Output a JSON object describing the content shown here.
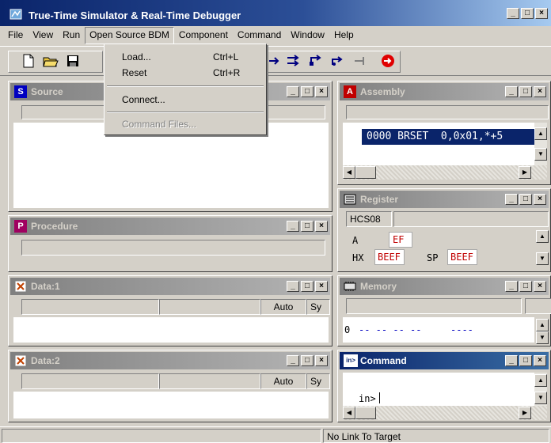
{
  "app": {
    "title": "True-Time Simulator & Real-Time Debugger"
  },
  "caption_buttons": {
    "minimize": "_",
    "maximize": "□",
    "close": "×"
  },
  "menu": [
    "File",
    "View",
    "Run",
    "Open Source BDM",
    "Component",
    "Command",
    "Window",
    "Help"
  ],
  "dropdown": {
    "items": [
      {
        "label": "Load...",
        "shortcut": "Ctrl+L",
        "enabled": true
      },
      {
        "label": "Reset",
        "shortcut": "Ctrl+R",
        "enabled": true
      },
      {
        "label": "Connect...",
        "shortcut": "",
        "enabled": true
      },
      {
        "label": "Command Files...",
        "shortcut": "",
        "enabled": false
      }
    ]
  },
  "windows": {
    "source": {
      "icon": "S",
      "title": "Source"
    },
    "procedure": {
      "icon": "P",
      "title": "Procedure"
    },
    "data1": {
      "title": "Data:1",
      "auto": "Auto",
      "sym": "Sy"
    },
    "data2": {
      "title": "Data:2",
      "auto": "Auto",
      "sym": "Sy"
    },
    "assembly": {
      "icon": "A",
      "title": "Assembly",
      "line": "0000 BRSET  0,0x01,*+5"
    },
    "register": {
      "title": "Register",
      "cpu": "HCS08",
      "a_label": "A",
      "a_value": "EF",
      "hx_label": "HX",
      "hx_value": "BEEF",
      "sp_label": "SP",
      "sp_value": "BEEF"
    },
    "memory": {
      "title": "Memory",
      "addr": "0",
      "bytes": "-- -- -- --",
      "ascii": "----"
    },
    "command": {
      "icon": "in>",
      "title": "Command",
      "prompt": "in>"
    }
  },
  "status": {
    "text": "No Link To Target"
  },
  "colors": {
    "title_active": "#0a246a",
    "title_inactive": "#808080",
    "register_value": "#c00000",
    "selection": "#0a246a"
  }
}
